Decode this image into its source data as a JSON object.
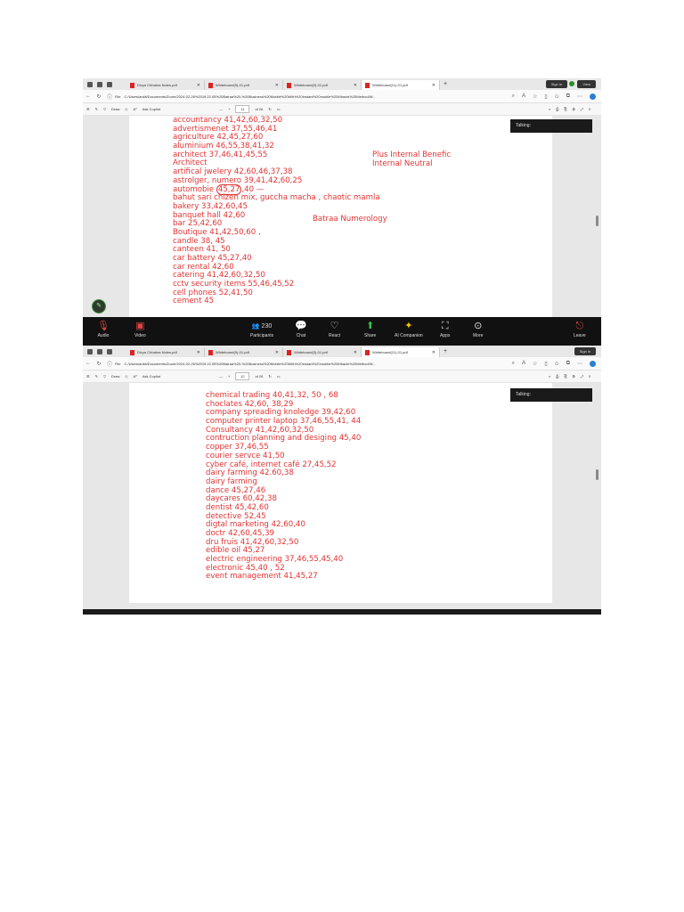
{
  "top_browser": {
    "tabs": [
      "Divya Chhabra Notes.pdf",
      "Whiteboard(9)-01.pdf",
      "Whiteboard(3)-01.pdf",
      "Whiteboard(11)-01.pdf"
    ],
    "new_tab": "+",
    "sign_in": "Sign in",
    "view": "View",
    "file_label": "File",
    "url": "C:/Users/ankit/Documents/Zoom/2024-02-26%2019.22.05%20Batraa%20-%20Business%20Mobile%20With%20Instant%20mobile%20Miracle%20Method/W...",
    "draw_label": "Draw",
    "ask_copilot": "Ask Copilot",
    "page_num": "11",
    "page_total": "of 26",
    "talking": "Talking:"
  },
  "top_list": [
    "accountancy     41,42,60,32,50",
    "advertismenet  37,55,46,41",
    "agriculture   42,45,27,60",
    "aluminium  46,55,38,41,32",
    "architect       37,46,41,45,55",
    "Architect",
    "artifical jwelery       42,60,46,37,38",
    "astrolger, numero      39,41,42,60,25",
    "automobie",
    "bahut sari chizen mix, guccha macha , chaotic mamla",
    "bakery     33,42,60,45",
    "banquet hall      42,60",
    "bar      25,42,60",
    "Boutique     41,42,50,60 ,",
    "candle      38, 45",
    "canteen      41, 50",
    "car battery 45,27,40",
    "car rental    42,60",
    "catering      41,42,60,32,50",
    "cctv security items      55,46,45,52",
    "cell phones       52,41,50",
    "cement           45"
  ],
  "automobile_circled": "45,27",
  "automobile_rest": ",40  —",
  "notes": {
    "plus_internal": "Plus Internal Benefic",
    "internal_neutral": "Internal Neutral",
    "batraa": "Batraa Numerology"
  },
  "zoom_bar": {
    "audio": "Audio",
    "video": "Video",
    "participants_count": "230",
    "participants": "Participants",
    "chat": "Chat",
    "react": "React",
    "share": "Share",
    "ai_companion": "AI Companion",
    "apps": "Apps",
    "more": "More",
    "leave": "Leave"
  },
  "bottom_browser": {
    "tabs": [
      "Divya Chhabra Notes.pdf",
      "Whiteboard(9)-01.pdf",
      "Whiteboard(3)-01.pdf",
      "Whiteboard(11)-01.pdf"
    ],
    "sign_in": "Sign in",
    "page_num": "12",
    "page_total": "of 26",
    "talking": "Talking:"
  },
  "bottom_list": [
    "chemical trading    40,41,32, 50 , 68",
    "choclates    42,60, 38,29",
    "company spreading knoledge    39,42,60",
    "computer printer laptop      37,46,55,41, 44",
    "Consultancy      41,42,60,32,50",
    "contruction planning and desiging  45,40",
    "copper  37,46,55",
    "courier servce  41,50",
    "cyber café, internet café     27,45,52",
    "dairy farming  42.60,38",
    "dairy farming",
    "dance  45,27,46",
    "daycares    60,42,38",
    "dentist 45,42,60",
    "detective    52,45",
    "digtal marketing      42,60,40",
    "doctr    42,60,45,39",
    "dru fruis     41,42,60,32,50",
    "edible oil     45,27",
    "electric engineering      37,46,55,45,40",
    "electronic   45,40 , 52",
    "event management       41,45,27"
  ]
}
